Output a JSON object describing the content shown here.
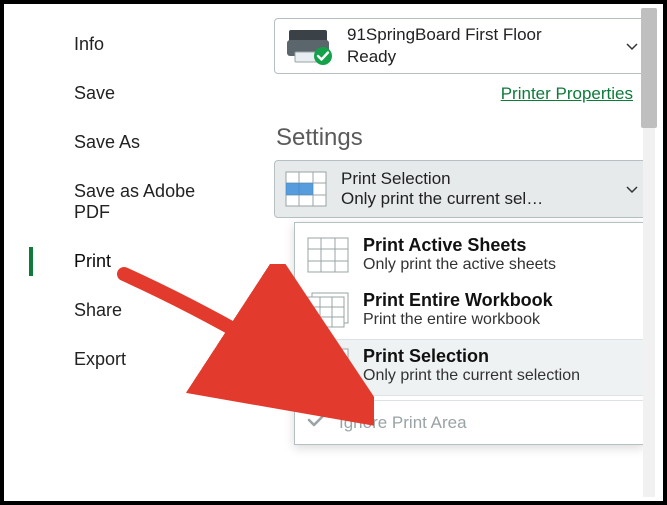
{
  "sidebar": {
    "items": [
      {
        "label": "Info"
      },
      {
        "label": "Save"
      },
      {
        "label": "Save As"
      },
      {
        "label": "Save as Adobe PDF"
      },
      {
        "label": "Print"
      },
      {
        "label": "Share"
      },
      {
        "label": "Export"
      }
    ]
  },
  "printer": {
    "name": "91SpringBoard First Floor",
    "status": "Ready",
    "propertiesLink": "Printer Properties"
  },
  "settings": {
    "title": "Settings",
    "selected": {
      "title": "Print Selection",
      "sub": "Only print the current sele…"
    }
  },
  "options": {
    "activeSheets": {
      "title": "Print Active Sheets",
      "sub": "Only print the active sheets"
    },
    "entireWorkbook": {
      "title": "Print Entire Workbook",
      "sub": "Print the entire workbook"
    },
    "printSelection": {
      "title": "Print Selection",
      "sub": "Only print the current selection"
    },
    "ignorePrintArea": "Ignore Print Area"
  }
}
